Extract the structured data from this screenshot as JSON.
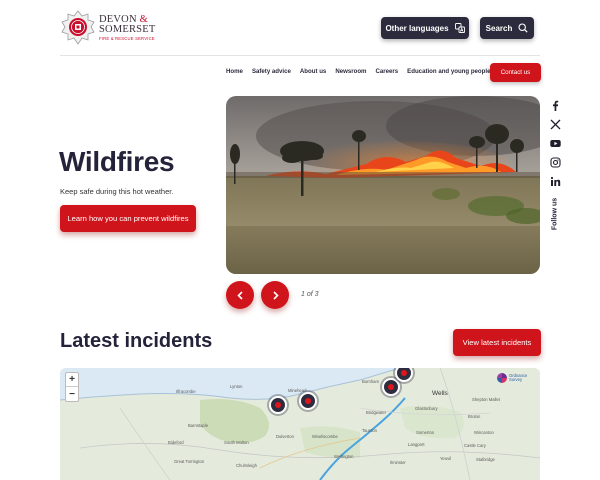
{
  "header": {
    "logo": {
      "line1": "DEVON",
      "ampersand": "&",
      "line2": "SOMERSET",
      "sub": "FIRE & RESCUE SERVICE"
    },
    "other_languages": "Other languages",
    "search": "Search"
  },
  "nav": {
    "items": [
      {
        "label": "Home"
      },
      {
        "label": "Safety advice"
      },
      {
        "label": "About us"
      },
      {
        "label": "Newsroom"
      },
      {
        "label": "Careers"
      },
      {
        "label": "Education and young people"
      }
    ],
    "contact": "Contact us"
  },
  "hero": {
    "title": "Wildfires",
    "subtitle": "Keep safe during this hot weather.",
    "cta": "Learn how you can prevent wildfires",
    "slide_counter": "1 of 3",
    "image_icon": "wildfire-photo"
  },
  "social": {
    "icons": [
      "facebook-icon",
      "x-icon",
      "youtube-icon",
      "instagram-icon",
      "linkedin-icon"
    ],
    "follow_label": "Follow us"
  },
  "incidents": {
    "title": "Latest incidents",
    "view_button": "View latest incidents",
    "zoom_in": "+",
    "zoom_out": "−",
    "attribution_line1": "Ordnance",
    "attribution_line2": "Survey",
    "places": [
      {
        "name": "Wells"
      },
      {
        "name": "Burnham"
      },
      {
        "name": "Bridgwater"
      },
      {
        "name": "Glastonbury"
      },
      {
        "name": "Lynton"
      },
      {
        "name": "Minehead"
      },
      {
        "name": "Ilfracombe"
      },
      {
        "name": "Barnstaple"
      },
      {
        "name": "South Molton"
      },
      {
        "name": "Dulverton"
      },
      {
        "name": "Wiveliscombe"
      },
      {
        "name": "Taunton"
      },
      {
        "name": "Somerton"
      },
      {
        "name": "Langport"
      },
      {
        "name": "Bruton"
      },
      {
        "name": "Wincanton"
      },
      {
        "name": "Bideford"
      },
      {
        "name": "Great Torrington"
      },
      {
        "name": "Chulmleigh"
      },
      {
        "name": "Wellington"
      },
      {
        "name": "Ilminster"
      },
      {
        "name": "Yeovil"
      },
      {
        "name": "Shepton Mallet"
      },
      {
        "name": "Castle Cary"
      },
      {
        "name": "Stalbridge"
      }
    ]
  },
  "colors": {
    "brand_red": "#d0141b",
    "navy": "#2b2b3d",
    "heading": "#25233a"
  }
}
